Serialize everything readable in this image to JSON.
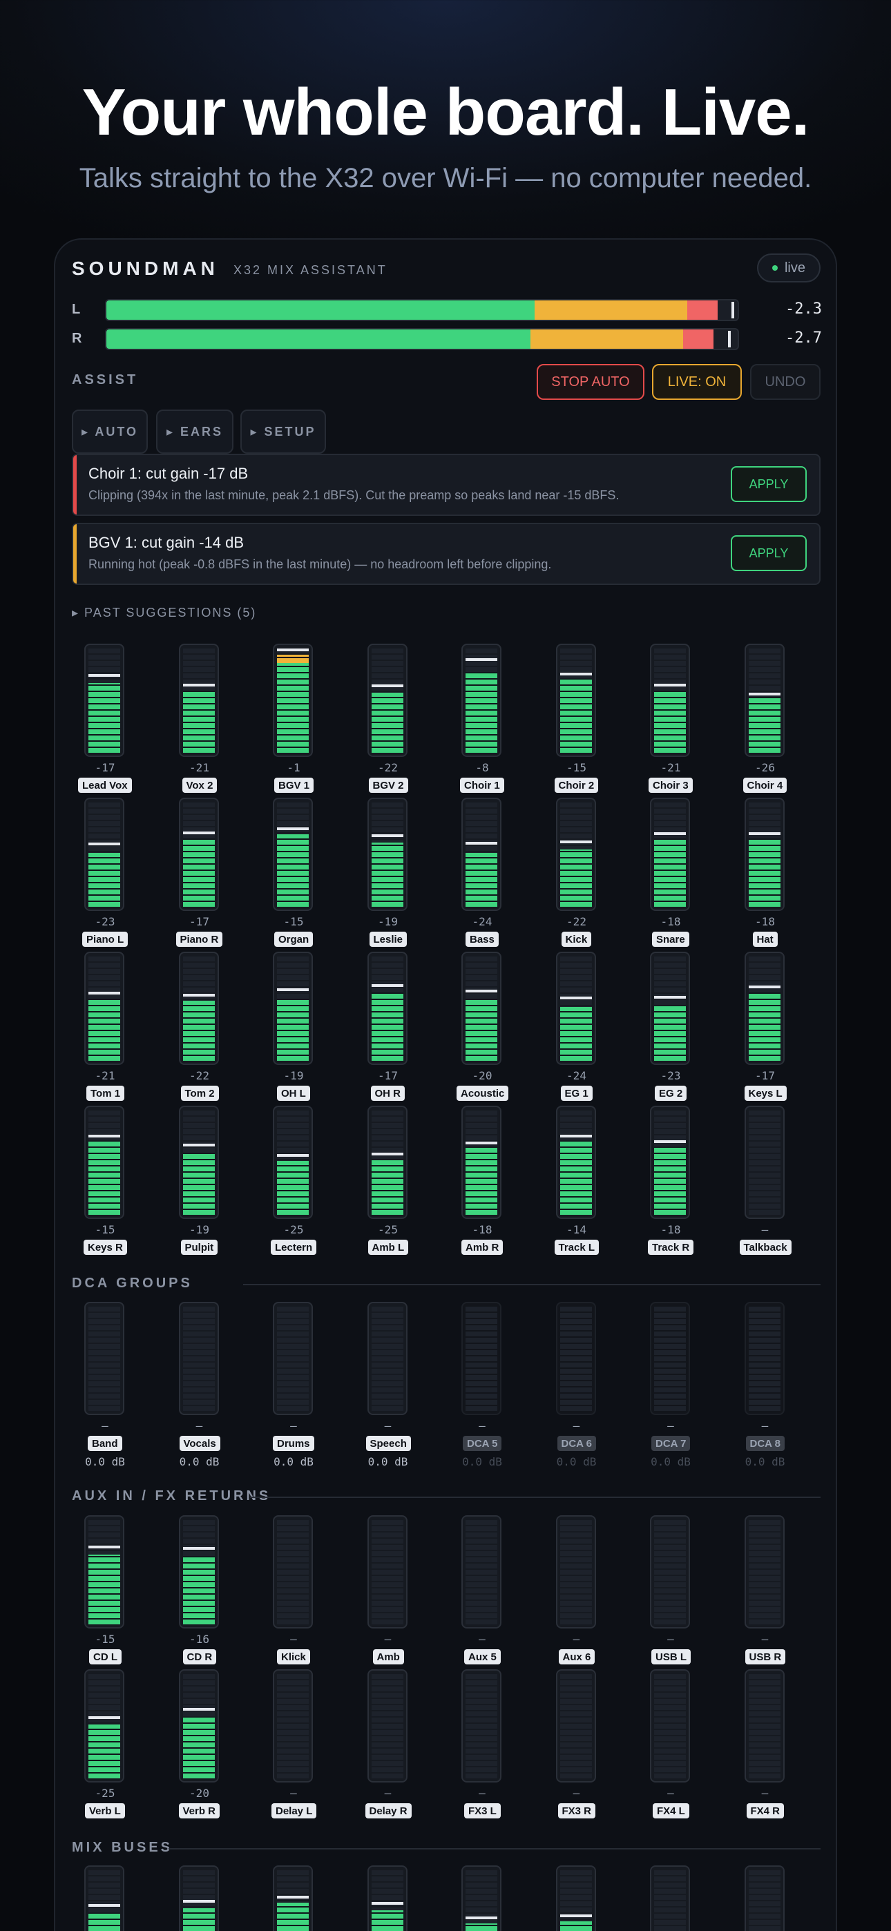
{
  "hero": {
    "title": "Your whole board. Live.",
    "subtitle": "Talks straight to the X32 over Wi-Fi — no computer needed."
  },
  "app": {
    "brand": "SOUNDMAN",
    "brand_sub": "X32 MIX ASSISTANT",
    "status": "live"
  },
  "colors": {
    "green": "#3fd47e",
    "amber": "#f0b33a",
    "red": "#f06565"
  },
  "main_meters": [
    {
      "label": "L",
      "value": "-2.3",
      "green_frac": 0.678,
      "amber_frac": 0.242,
      "red_frac": 0.048,
      "peak_frac": 0.99
    },
    {
      "label": "R",
      "value": "-2.7",
      "green_frac": 0.672,
      "amber_frac": 0.242,
      "red_frac": 0.048,
      "peak_frac": 0.985
    }
  ],
  "assist": {
    "label": "ASSIST",
    "stop_label": "STOP AUTO",
    "live_label": "LIVE: ON",
    "undo_label": "UNDO",
    "tabs": [
      "▸ AUTO",
      "▸ EARS",
      "▸ SETUP"
    ]
  },
  "suggestions": [
    {
      "title": "Choir 1: cut gain -17 dB",
      "text": "Clipping (394x in the last minute, peak 2.1 dBFS). Cut the preamp so peaks land near -15 dBFS.",
      "apply": "APPLY",
      "severity": "red"
    },
    {
      "title": "BGV 1: cut gain -14 dB",
      "text": "Running hot (peak -0.8 dBFS in the last minute) — no headroom left before clipping.",
      "apply": "APPLY",
      "severity": "amber"
    }
  ],
  "past_suggestions": "▸ PAST SUGGESTIONS (5)",
  "channels": [
    {
      "name": "Lead Vox",
      "val": "-17",
      "level": 0.68,
      "peak": 0.74
    },
    {
      "name": "Vox 2",
      "val": "-21",
      "level": 0.6,
      "peak": 0.65
    },
    {
      "name": "BGV 1",
      "val": "-1",
      "level": 0.96,
      "peak": 0.99,
      "hot": 0.08
    },
    {
      "name": "BGV 2",
      "val": "-22",
      "level": 0.59,
      "peak": 0.64
    },
    {
      "name": "Choir 1",
      "val": "-8",
      "level": 0.79,
      "peak": 0.9
    },
    {
      "name": "Choir 2",
      "val": "-15",
      "level": 0.72,
      "peak": 0.76
    },
    {
      "name": "Choir 3",
      "val": "-21",
      "level": 0.6,
      "peak": 0.65
    },
    {
      "name": "Choir 4",
      "val": "-26",
      "level": 0.55,
      "peak": 0.56
    },
    {
      "name": "Piano L",
      "val": "-23",
      "level": 0.53,
      "peak": 0.6
    },
    {
      "name": "Piano R",
      "val": "-17",
      "level": 0.67,
      "peak": 0.71
    },
    {
      "name": "Organ",
      "val": "-15",
      "level": 0.71,
      "peak": 0.75
    },
    {
      "name": "Leslie",
      "val": "-19",
      "level": 0.63,
      "peak": 0.68
    },
    {
      "name": "Bass",
      "val": "-24",
      "level": 0.53,
      "peak": 0.61
    },
    {
      "name": "Kick",
      "val": "-22",
      "level": 0.56,
      "peak": 0.62
    },
    {
      "name": "Snare",
      "val": "-18",
      "level": 0.67,
      "peak": 0.7
    },
    {
      "name": "Hat",
      "val": "-18",
      "level": 0.67,
      "peak": 0.7
    },
    {
      "name": "Tom 1",
      "val": "-21",
      "level": 0.6,
      "peak": 0.65
    },
    {
      "name": "Tom 2",
      "val": "-22",
      "level": 0.59,
      "peak": 0.63
    },
    {
      "name": "OH L",
      "val": "-19",
      "level": 0.6,
      "peak": 0.68
    },
    {
      "name": "OH R",
      "val": "-17",
      "level": 0.67,
      "peak": 0.72
    },
    {
      "name": "Acoustic",
      "val": "-20",
      "level": 0.6,
      "peak": 0.67
    },
    {
      "name": "EG 1",
      "val": "-24",
      "level": 0.53,
      "peak": 0.6
    },
    {
      "name": "EG 2",
      "val": "-23",
      "level": 0.54,
      "peak": 0.61
    },
    {
      "name": "Keys L",
      "val": "-17",
      "level": 0.67,
      "peak": 0.71
    },
    {
      "name": "Keys R",
      "val": "-15",
      "level": 0.72,
      "peak": 0.76
    },
    {
      "name": "Pulpit",
      "val": "-19",
      "level": 0.6,
      "peak": 0.67
    },
    {
      "name": "Lectern",
      "val": "-25",
      "level": 0.53,
      "peak": 0.57
    },
    {
      "name": "Amb L",
      "val": "-25",
      "level": 0.54,
      "peak": 0.58
    },
    {
      "name": "Amb R",
      "val": "-18",
      "level": 0.66,
      "peak": 0.69
    },
    {
      "name": "Track L",
      "val": "-14",
      "level": 0.72,
      "peak": 0.76
    },
    {
      "name": "Track R",
      "val": "-18",
      "level": 0.66,
      "peak": 0.7
    },
    {
      "name": "Talkback",
      "val": "–",
      "level": 0,
      "peak": 0
    }
  ],
  "dca": {
    "label": "DCA GROUPS",
    "items": [
      {
        "name": "Band",
        "val": "–",
        "db": "0.0 dB",
        "on": true
      },
      {
        "name": "Vocals",
        "val": "–",
        "db": "0.0 dB",
        "on": true
      },
      {
        "name": "Drums",
        "val": "–",
        "db": "0.0 dB",
        "on": true
      },
      {
        "name": "Speech",
        "val": "–",
        "db": "0.0 dB",
        "on": true
      },
      {
        "name": "DCA 5",
        "val": "–",
        "db": "0.0 dB",
        "on": false
      },
      {
        "name": "DCA 6",
        "val": "–",
        "db": "0.0 dB",
        "on": false
      },
      {
        "name": "DCA 7",
        "val": "–",
        "db": "0.0 dB",
        "on": false
      },
      {
        "name": "DCA 8",
        "val": "–",
        "db": "0.0 dB",
        "on": false
      }
    ]
  },
  "aux": {
    "label": "AUX IN / FX RETURNS",
    "items": [
      {
        "name": "CD L",
        "val": "-15",
        "level": 0.68,
        "peak": 0.74
      },
      {
        "name": "CD R",
        "val": "-16",
        "level": 0.67,
        "peak": 0.73
      },
      {
        "name": "Klick",
        "val": "–",
        "level": 0,
        "peak": 0
      },
      {
        "name": "Amb",
        "val": "–",
        "level": 0,
        "peak": 0
      },
      {
        "name": "Aux 5",
        "val": "–",
        "level": 0,
        "peak": 0
      },
      {
        "name": "Aux 6",
        "val": "–",
        "level": 0,
        "peak": 0
      },
      {
        "name": "USB L",
        "val": "–",
        "level": 0,
        "peak": 0
      },
      {
        "name": "USB R",
        "val": "–",
        "level": 0,
        "peak": 0
      },
      {
        "name": "Verb L",
        "val": "-25",
        "level": 0.53,
        "peak": 0.58
      },
      {
        "name": "Verb R",
        "val": "-20",
        "level": 0.6,
        "peak": 0.66
      },
      {
        "name": "Delay L",
        "val": "–",
        "level": 0,
        "peak": 0
      },
      {
        "name": "Delay R",
        "val": "–",
        "level": 0,
        "peak": 0
      },
      {
        "name": "FX3 L",
        "val": "–",
        "level": 0,
        "peak": 0
      },
      {
        "name": "FX3 R",
        "val": "–",
        "level": 0,
        "peak": 0
      },
      {
        "name": "FX4 L",
        "val": "–",
        "level": 0,
        "peak": 0
      },
      {
        "name": "FX4 R",
        "val": "–",
        "level": 0,
        "peak": 0
      }
    ]
  },
  "mix": {
    "label": "MIX BUSES",
    "items": [
      {
        "level": 0.6,
        "peak": 0.66
      },
      {
        "level": 0.65,
        "peak": 0.7
      },
      {
        "level": 0.7,
        "peak": 0.74
      },
      {
        "level": 0.63,
        "peak": 0.68
      },
      {
        "level": 0.5,
        "peak": 0.54
      },
      {
        "level": 0.52,
        "peak": 0.56
      },
      {
        "level": 0,
        "peak": 0
      },
      {
        "level": 0,
        "peak": 0
      }
    ]
  }
}
